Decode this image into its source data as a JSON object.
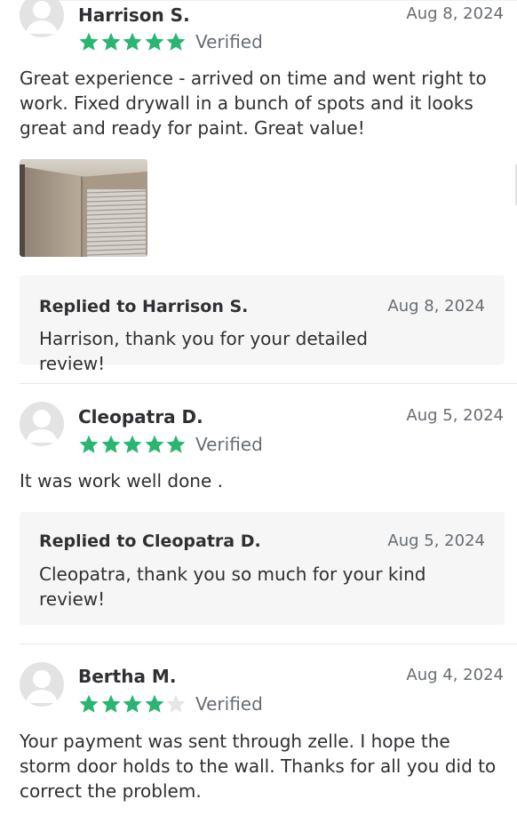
{
  "reviews": [
    {
      "name": "Harrison S.",
      "date": "Aug 8, 2024",
      "rating": 5,
      "verified_label": "Verified",
      "text": "Great experience - arrived on time and went right to work. Fixed drywall in a bunch of spots and it looks great and ready for paint. Great value!",
      "has_photo": true,
      "reply": {
        "title": "Replied to Harrison S.",
        "date": "Aug 8, 2024",
        "text": "Harrison, thank you for your detailed review!"
      }
    },
    {
      "name": "Cleopatra D.",
      "date": "Aug 5, 2024",
      "rating": 5,
      "verified_label": "Verified",
      "text": "It was work well done .",
      "has_photo": false,
      "reply": {
        "title": "Replied to Cleopatra D.",
        "date": "Aug 5, 2024",
        "text": "Cleopatra, thank you so much for your kind review!"
      }
    },
    {
      "name": "Bertha M.",
      "date": "Aug 4, 2024",
      "rating": 4,
      "verified_label": "Verified",
      "text": "Your payment was sent through zelle.  I hope the storm door holds to the wall. Thanks for all you did to correct the problem.",
      "has_photo": false
    }
  ],
  "colors": {
    "star_filled": "#2bb573",
    "star_empty": "#e6e6e6",
    "reply_background": "#f6f6f6",
    "muted_text": "#676d73"
  },
  "icons": {
    "avatar": "default-user-avatar-icon",
    "star": "star-icon"
  }
}
